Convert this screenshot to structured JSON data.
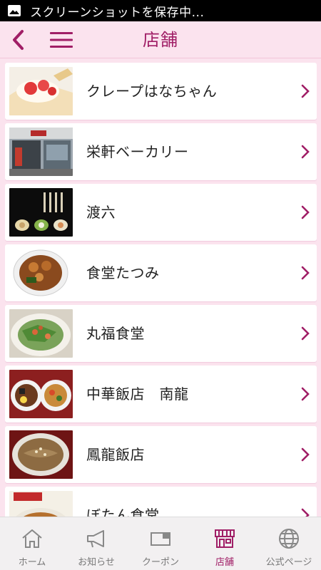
{
  "status_bar": {
    "notification_text": "スクリーンショットを保存中..."
  },
  "header": {
    "title": "店舗"
  },
  "stores": [
    {
      "name": "クレープはなちゃん",
      "thumb": "crepe"
    },
    {
      "name": "栄軒ベーカリー",
      "thumb": "bakery"
    },
    {
      "name": "渡六",
      "thumb": "rollcake"
    },
    {
      "name": "食堂たつみ",
      "thumb": "ramen-bowl"
    },
    {
      "name": "丸福食堂",
      "thumb": "salad-plate"
    },
    {
      "name": "中華飯店　南龍",
      "thumb": "two-bowls"
    },
    {
      "name": "鳳龍飯店",
      "thumb": "noodle-soup"
    },
    {
      "name": "ぼたん食堂",
      "thumb": "yakisoba"
    }
  ],
  "bottom_nav": [
    {
      "label": "ホーム",
      "icon": "home-icon"
    },
    {
      "label": "お知らせ",
      "icon": "megaphone-icon"
    },
    {
      "label": "クーポン",
      "icon": "coupon-icon"
    },
    {
      "label": "店舗",
      "icon": "shop-icon",
      "active": true
    },
    {
      "label": "公式ページ",
      "icon": "globe-icon"
    }
  ],
  "colors": {
    "accent": "#a01e66",
    "background": "#fbe3ee",
    "chevron": "#a01e66"
  }
}
